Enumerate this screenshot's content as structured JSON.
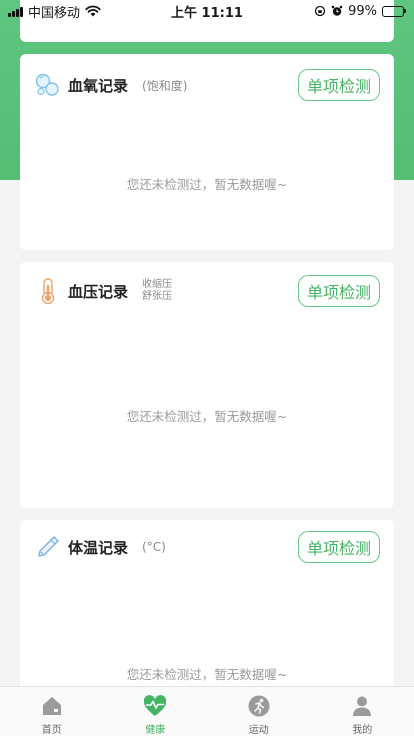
{
  "status_bar": {
    "carrier": "中国移动",
    "time": "上午 11:11",
    "battery": "99%"
  },
  "colors": {
    "accent": "#43b464",
    "header_green": "#5fc680"
  },
  "cards": {
    "oxygen": {
      "title": "血氧记录",
      "sub": "(饱和度)",
      "button": "单项检测",
      "empty": "您还未检测过，暂无数据喔~",
      "icon": "oxygen-bubbles-icon"
    },
    "pressure": {
      "title": "血压记录",
      "sub_top": "收缩压",
      "sub_bottom": "舒张压",
      "button": "单项检测",
      "empty": "您还未检测过，暂无数据喔~",
      "icon": "thermometer-icon"
    },
    "temperature": {
      "title": "体温记录",
      "sub": "(°C)",
      "button": "单项检测",
      "empty": "您还未检测过，暂无数据喔~",
      "icon": "pen-thermometer-icon"
    }
  },
  "tabbar": {
    "items": [
      {
        "label": "首页",
        "icon": "home-icon"
      },
      {
        "label": "健康",
        "icon": "heart-pulse-icon"
      },
      {
        "label": "运动",
        "icon": "running-icon"
      },
      {
        "label": "我的",
        "icon": "person-icon"
      }
    ],
    "active": "健康"
  }
}
